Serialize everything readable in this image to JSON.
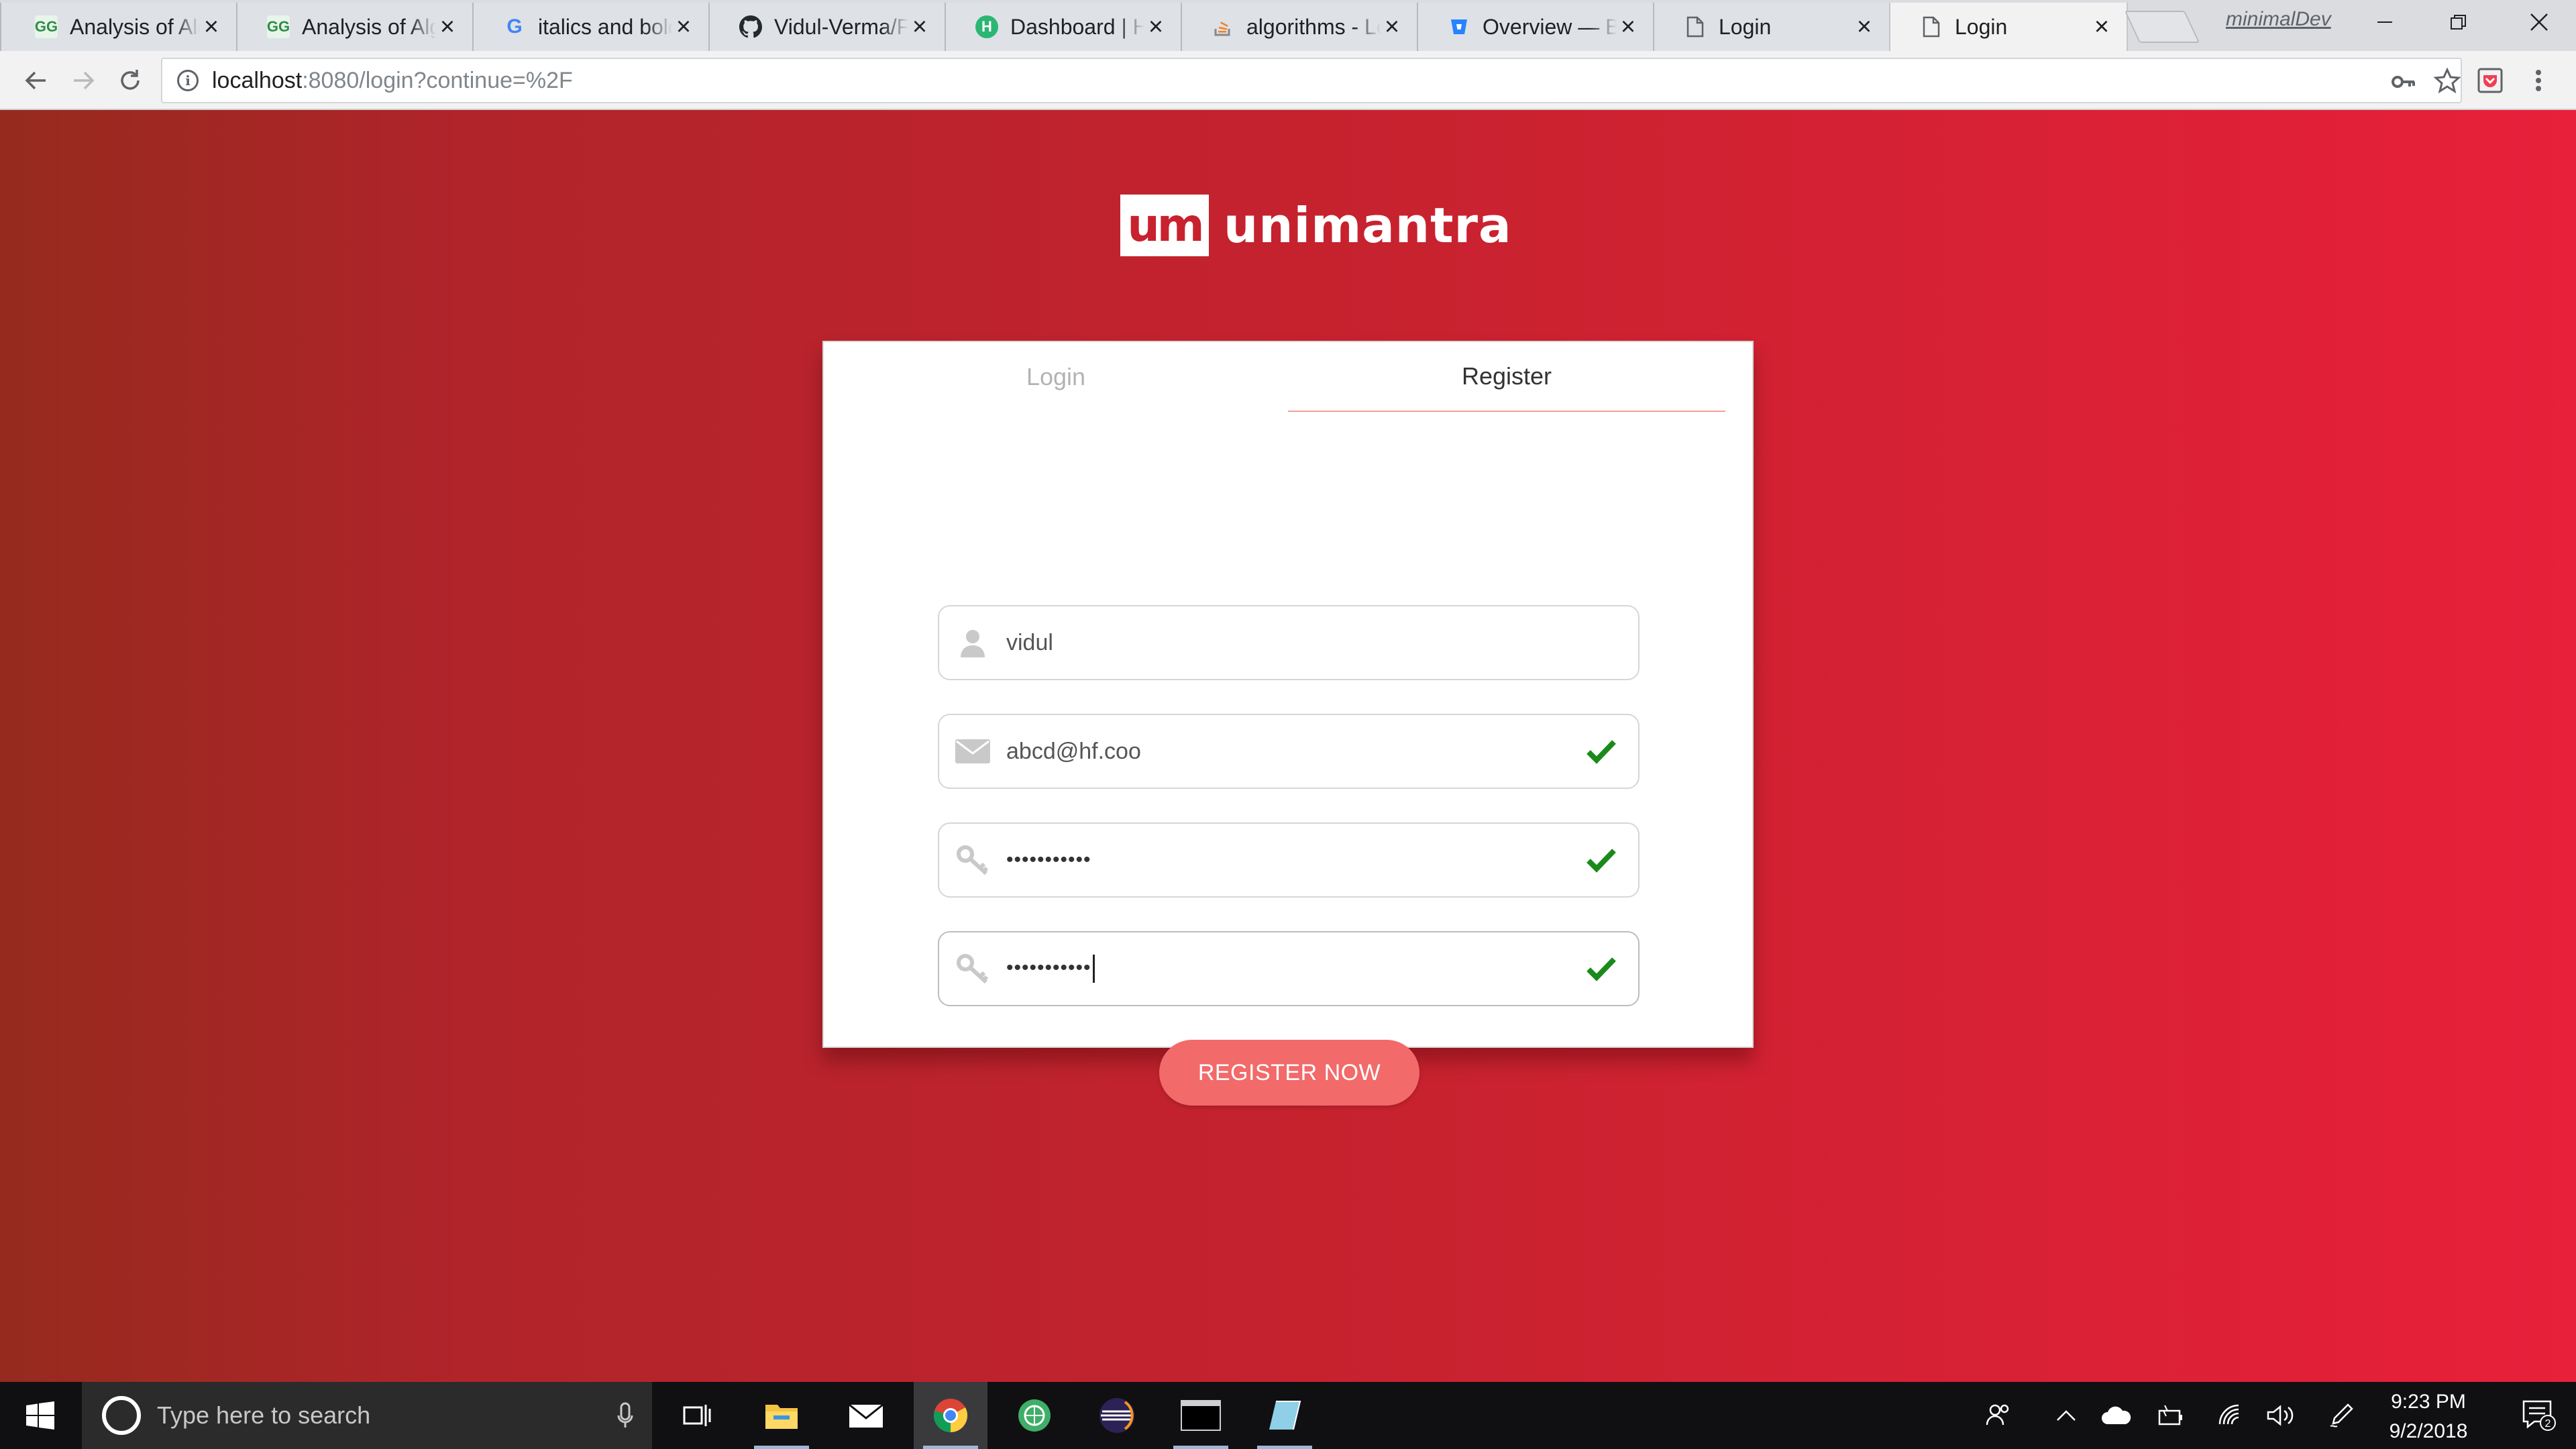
{
  "browser": {
    "tabs": [
      {
        "title": "Analysis of Algorithms",
        "favicon": "geeksforgeeks-icon",
        "active": false
      },
      {
        "title": "Analysis of Algorithms",
        "favicon": "geeksforgeeks-icon",
        "active": false
      },
      {
        "title": "italics and bold",
        "favicon": "google-icon",
        "active": false
      },
      {
        "title": "Vidul-Verma/Fc",
        "favicon": "github-icon",
        "active": false
      },
      {
        "title": "Dashboard | Ha",
        "favicon": "hackerearth-icon",
        "active": false
      },
      {
        "title": "algorithms - Lo",
        "favicon": "stackoverflow-icon",
        "active": false
      },
      {
        "title": "Overview — Bi",
        "favicon": "bitbucket-icon",
        "active": false
      },
      {
        "title": "Login",
        "favicon": "page-icon",
        "active": false
      },
      {
        "title": "Login",
        "favicon": "page-icon",
        "active": true
      }
    ],
    "profile_name": "minimalDev",
    "url_host": "localhost",
    "url_path": ":8080/login?continue=%2F"
  },
  "page": {
    "brand_mark": "um",
    "brand_name": "unimantra",
    "tabs": {
      "login": "Login",
      "register": "Register"
    },
    "fields": {
      "username": "vidul",
      "email": "abcd@hf.coo",
      "password": "•••••••••••",
      "confirm_password": "•••••••••••"
    },
    "register_button": "REGISTER NOW",
    "colors": {
      "accent": "#f26a6a",
      "valid_check": "#1a8a1a",
      "bg_left": "#962a1e",
      "bg_right": "#e8203a"
    }
  },
  "taskbar": {
    "search_placeholder": "Type here to search",
    "time": "9:23 PM",
    "date": "9/2/2018",
    "notification_count": "2"
  }
}
